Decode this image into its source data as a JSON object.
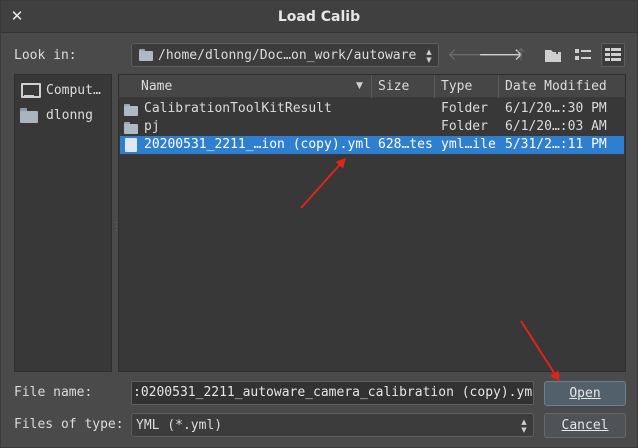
{
  "window": {
    "title": "Load Calib"
  },
  "toolbar": {
    "look_in_label": "Look in:",
    "path": "/home/dlonng/Doc…on_work/autoware"
  },
  "sidebar": {
    "items": [
      {
        "label": "Comput…",
        "icon": "monitor-icon"
      },
      {
        "label": "dlonng",
        "icon": "folder-icon"
      }
    ]
  },
  "filelist": {
    "columns": {
      "name": "Name",
      "size": "Size",
      "type": "Type",
      "date": "Date Modified"
    },
    "rows": [
      {
        "name": "CalibrationToolKitResult",
        "size": "",
        "type": "Folder",
        "date": "6/1/20…:30 PM",
        "icon": "folder-icon",
        "selected": false
      },
      {
        "name": "pj",
        "size": "",
        "type": "Folder",
        "date": "6/1/20…:03 AM",
        "icon": "folder-icon",
        "selected": false
      },
      {
        "name": "20200531_2211_…ion (copy).yml",
        "size": "628…tes",
        "type": "yml…ile",
        "date": "5/31/2…:11 PM",
        "icon": "file-icon",
        "selected": true
      }
    ]
  },
  "footer": {
    "file_name_label": "File name:",
    "file_name_value": ":0200531_2211_autoware_camera_calibration (copy).yml",
    "files_of_type_label": "Files of type:",
    "files_of_type_value": "YML (*.yml)",
    "open_label": "Open",
    "cancel_label": "Cancel"
  },
  "colors": {
    "selection": "#2f7fd0",
    "annotation_arrow": "#e0241b"
  }
}
